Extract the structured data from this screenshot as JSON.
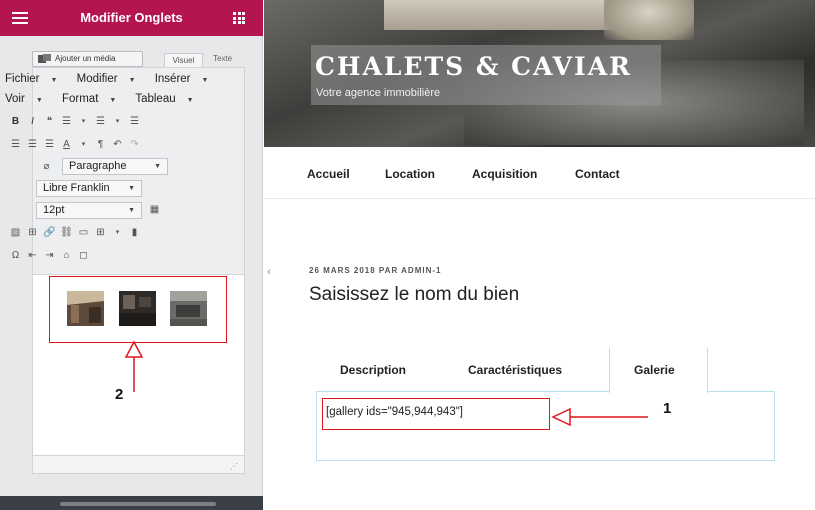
{
  "panel": {
    "title": "Modifier Onglets",
    "header_color": "#b5154f",
    "media_button": "Ajouter un média",
    "tab_visual": "Visuel",
    "tab_texte": "Texte",
    "menus": [
      {
        "label": "Fichier"
      },
      {
        "label": "Modifier"
      },
      {
        "label": "Insérer"
      }
    ],
    "menus2": [
      {
        "label": "Voir"
      },
      {
        "label": "Format"
      },
      {
        "label": "Tableau"
      }
    ],
    "format_select": "Paragraphe",
    "font_select": "Libre Franklin",
    "size_select": "12pt",
    "toolbar_row1": [
      "B",
      "I",
      "❝",
      "☰",
      "▾",
      "☰",
      "▾",
      "☰"
    ],
    "toolbar_row2": [
      "☰",
      "☰",
      "☰",
      "A",
      "▾",
      "¶",
      "↶",
      "↷"
    ],
    "toolbar_row4": [
      "▨",
      "⊞",
      "🔗",
      "⛓",
      "▭",
      "⊞",
      "▾",
      "▮"
    ],
    "toolbar_row5": [
      "Ω",
      "⇤",
      "⇥",
      "⌂",
      "◻"
    ]
  },
  "site": {
    "title": "CHALETS & CAVIAR",
    "tagline": "Votre agence immobilière",
    "nav": [
      "Accueil",
      "Location",
      "Acquisition",
      "Contact"
    ],
    "post_meta": "26 MARS 2018 PAR ADMIN-1",
    "post_title": "Saisissez le nom du bien",
    "tabs": [
      "Description",
      "Caractéristiques",
      "Galerie"
    ],
    "active_tab": "Galerie",
    "shortcode": "[gallery ids=\"945,944,943\"]"
  },
  "annotations": {
    "label_1": "1",
    "label_2": "2",
    "color": "#e0151c"
  }
}
